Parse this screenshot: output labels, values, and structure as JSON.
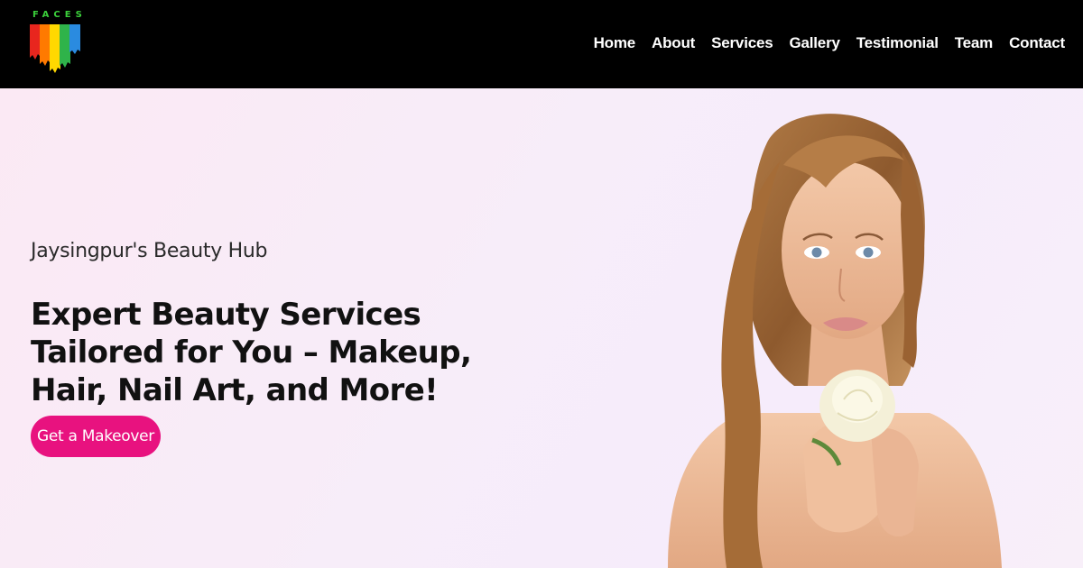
{
  "brand": {
    "name": "FACES",
    "stripe_colors": [
      "#e8261e",
      "#ff7a00",
      "#ffd800",
      "#2fb34a",
      "#2a8be0"
    ]
  },
  "nav": {
    "items": [
      {
        "label": "Home"
      },
      {
        "label": "About"
      },
      {
        "label": "Services"
      },
      {
        "label": "Gallery"
      },
      {
        "label": "Testimonial"
      },
      {
        "label": "Team"
      },
      {
        "label": "Contact"
      }
    ]
  },
  "hero": {
    "tagline": "Jaysingpur's Beauty Hub",
    "headline": "Expert Beauty Services Tailored for You – Makeup, Hair, Nail Art, and More!",
    "cta_label": "Get a Makeover",
    "accent_color": "#e8127f"
  }
}
